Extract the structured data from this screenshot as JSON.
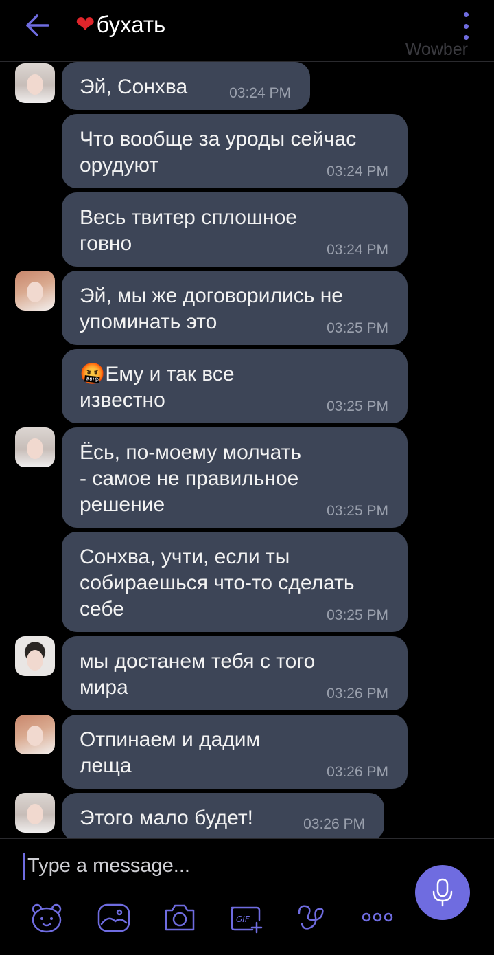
{
  "header": {
    "title": "бухать",
    "subtitle": "Wowber",
    "heart": "❤"
  },
  "messages": [
    {
      "text": "Эй, Сонхва",
      "time": "03:24 PM"
    },
    {
      "text": "Что вообще за уроды сейчас\nорудуют",
      "time": "03:24 PM"
    },
    {
      "text": "Весь твитер сплошное\nговно",
      "time": "03:24 PM"
    },
    {
      "text": "Эй, мы же договорились не\nупоминать это",
      "time": "03:25 PM"
    },
    {
      "emoji": "🤬",
      "text": "Ему и так все\nизвестно",
      "time": "03:25 PM"
    },
    {
      "text": "Ёсь, по-моему молчать\n- самое не правильное\nрешение",
      "time": "03:25 PM"
    },
    {
      "text": "Сонхва, учти, если ты\nсобираешься что-то сделать\nсебе",
      "time": "03:25 PM"
    },
    {
      "text": "мы достанем тебя с того\nмира",
      "time": "03:26 PM"
    },
    {
      "text": "Отпинаем и дадим\nлеща",
      "time": "03:26 PM"
    },
    {
      "text": "Этого мало будет!",
      "time": "03:26 PM"
    }
  ],
  "composer": {
    "placeholder": "Type a message..."
  },
  "toolbar": {
    "icons": [
      "sticker-bear-icon",
      "image-icon",
      "camera-icon",
      "gif-icon",
      "doodle-icon",
      "more-dots-icon"
    ],
    "gif_label": "GIF"
  },
  "colors": {
    "accent": "#6f6ce0",
    "bubble": "#3d4557",
    "background": "#000000",
    "timestamp": "#9aa0ad"
  }
}
